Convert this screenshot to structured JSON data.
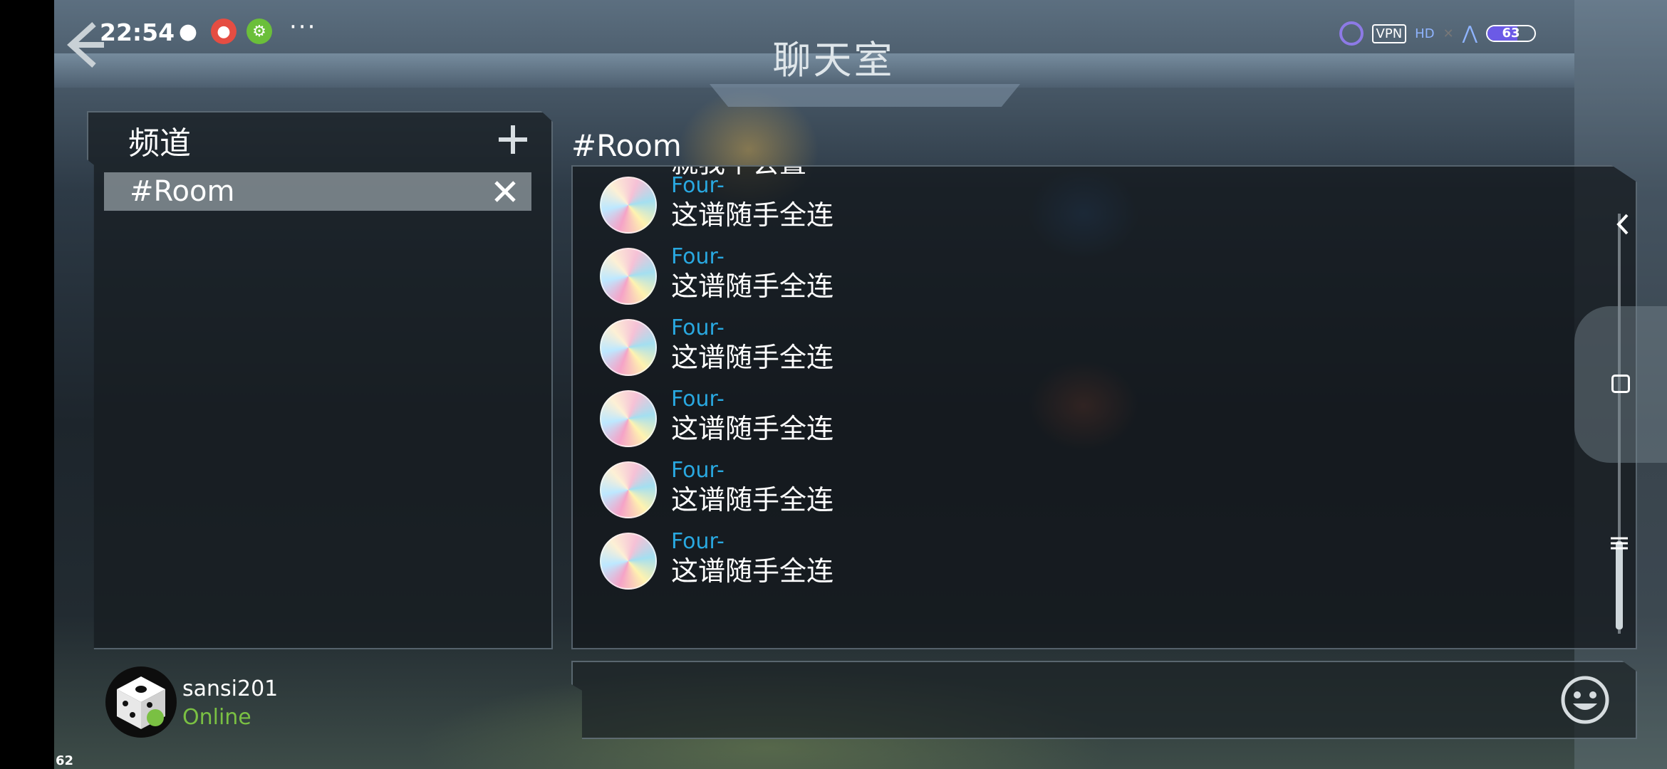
{
  "status_bar": {
    "time": "22:54",
    "icons": [
      "wechat-icon",
      "mushroom-icon",
      "gear-app-icon",
      "more-icon"
    ],
    "vpn_label": "VPN",
    "signal_label": "HD",
    "battery": 63,
    "battery_label": "63"
  },
  "header": {
    "title": "聊天室"
  },
  "channels": {
    "heading": "频道",
    "items": [
      {
        "label": "#Room"
      }
    ]
  },
  "chat": {
    "room_title": "#Room",
    "cut_text": "就我个会置",
    "messages": [
      {
        "user": "Four-",
        "text": "这谱随手全连"
      },
      {
        "user": "Four-",
        "text": "这谱随手全连"
      },
      {
        "user": "Four-",
        "text": "这谱随手全连"
      },
      {
        "user": "Four-",
        "text": "这谱随手全连"
      },
      {
        "user": "Four-",
        "text": "这谱随手全连"
      },
      {
        "user": "Four-",
        "text": "这谱随手全连"
      }
    ]
  },
  "input": {
    "value": "",
    "placeholder": ""
  },
  "user": {
    "name": "sansi201",
    "status": "Online"
  },
  "fps": "62",
  "colors": {
    "username": "#29a8e0",
    "online": "#7ac043",
    "battery_fill": "#6b5ae6"
  }
}
